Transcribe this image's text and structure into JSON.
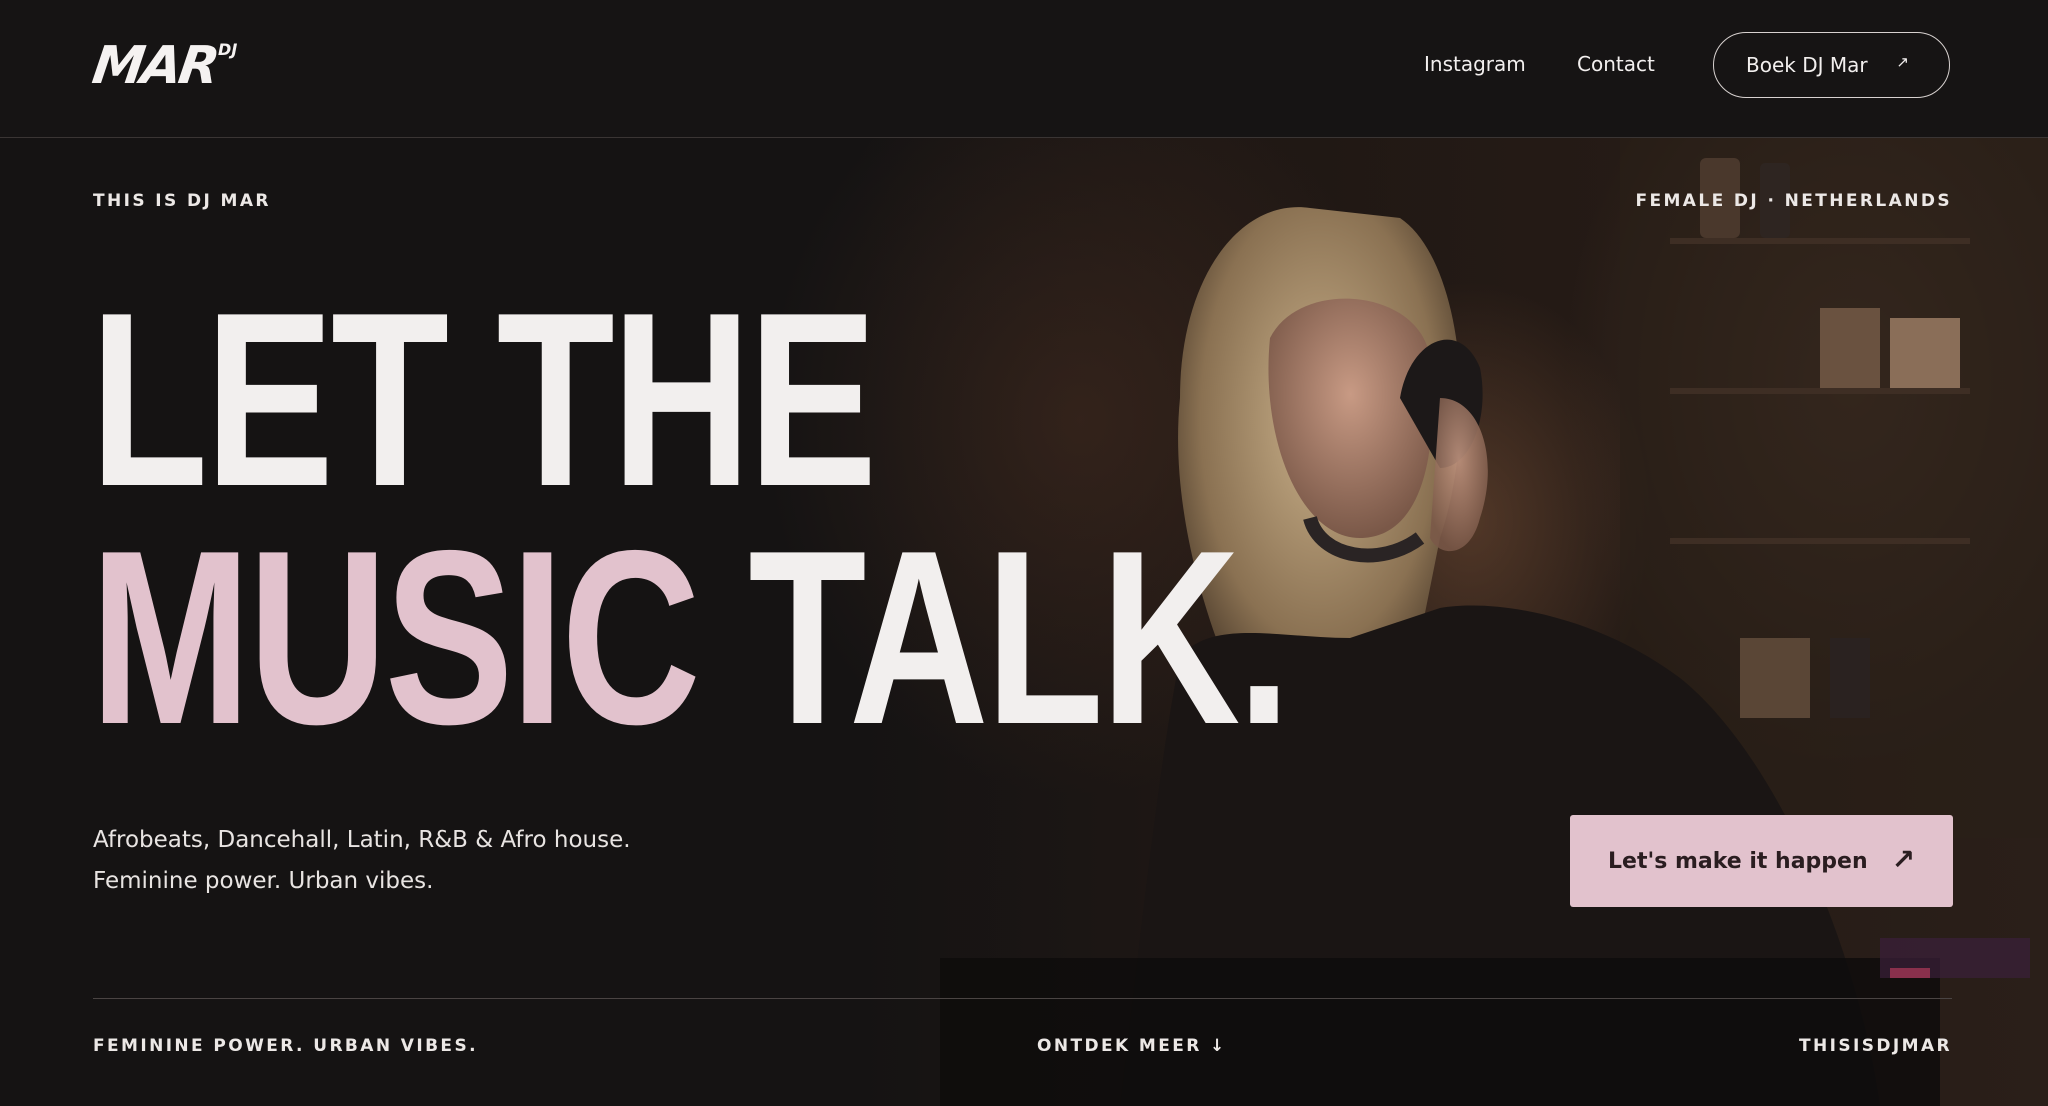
{
  "header": {
    "logo_text": "MAR",
    "logo_sup": "DJ",
    "nav": {
      "instagram": "Instagram",
      "contact": "Contact"
    },
    "book_label": "Boek DJ Mar",
    "book_arrow": "↗"
  },
  "hero": {
    "eyebrow_left": "THIS IS DJ MAR",
    "eyebrow_right": "FEMALE DJ · NETHERLANDS",
    "headline_line1": "LET THE",
    "headline_accent": "MUSIC",
    "headline_line2_rest": " TALK.",
    "tagline_1": "Afrobeats, Dancehall, Latin, R&B & Afro house.",
    "tagline_2": "Feminine power. Urban vibes.",
    "cta_label": "Let's make it happen",
    "cta_arrow": "↗"
  },
  "footer": {
    "left": "FEMININE POWER. URBAN VIBES.",
    "middle": "ONTDEK MEER ↓",
    "right": "THISISDJMAR"
  },
  "colors": {
    "background": "#141212",
    "accent_pink": "#e2c2cd",
    "text": "#f2efee"
  }
}
